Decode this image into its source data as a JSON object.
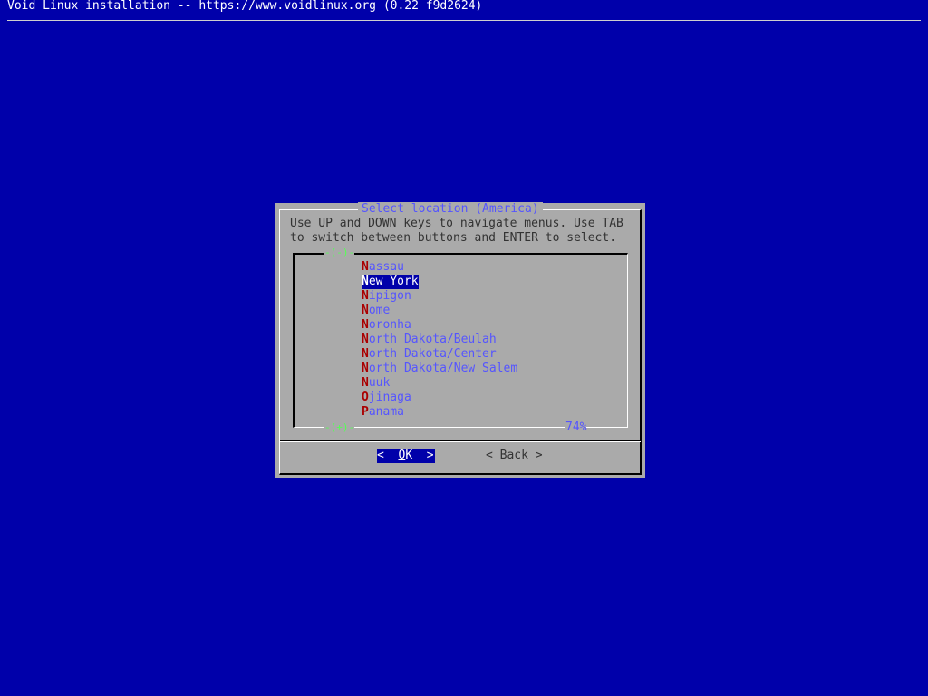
{
  "backtitle": "Void Linux installation -- https://www.voidlinux.org (0.22 f9d2624)",
  "dialog": {
    "title": "Select location (America)",
    "prompt_line1": "Use UP and DOWN keys to navigate menus. Use TAB",
    "prompt_line2": "to switch between buttons and ENTER to select.",
    "scroll_up": "-(-)-",
    "scroll_down": "-(+)-",
    "scroll_percent": "74%"
  },
  "menu": {
    "items": [
      {
        "hotkey": "N",
        "rest": "assau",
        "selected": false
      },
      {
        "hotkey": "N",
        "rest": "ew York",
        "selected": true
      },
      {
        "hotkey": "N",
        "rest": "ipigon",
        "selected": false
      },
      {
        "hotkey": "N",
        "rest": "ome",
        "selected": false
      },
      {
        "hotkey": "N",
        "rest": "oronha",
        "selected": false
      },
      {
        "hotkey": "N",
        "rest": "orth Dakota/Beulah",
        "selected": false
      },
      {
        "hotkey": "N",
        "rest": "orth Dakota/Center",
        "selected": false
      },
      {
        "hotkey": "N",
        "rest": "orth Dakota/New Salem",
        "selected": false
      },
      {
        "hotkey": "N",
        "rest": "uuk",
        "selected": false
      },
      {
        "hotkey": "O",
        "rest": "jinaga",
        "selected": false
      },
      {
        "hotkey": "P",
        "rest": "anama",
        "selected": false
      }
    ]
  },
  "buttons": {
    "ok": {
      "left": "<",
      "hot": "O",
      "rest": "K",
      "right": ">"
    },
    "back": {
      "left": "<",
      "label": "Back",
      "right": ">"
    }
  },
  "colors": {
    "background": "#0000aa",
    "dialog": "#aaaaaa",
    "title": "#5555ff",
    "hotkey": "#aa0000",
    "scroll_marker": "#55ff55"
  }
}
